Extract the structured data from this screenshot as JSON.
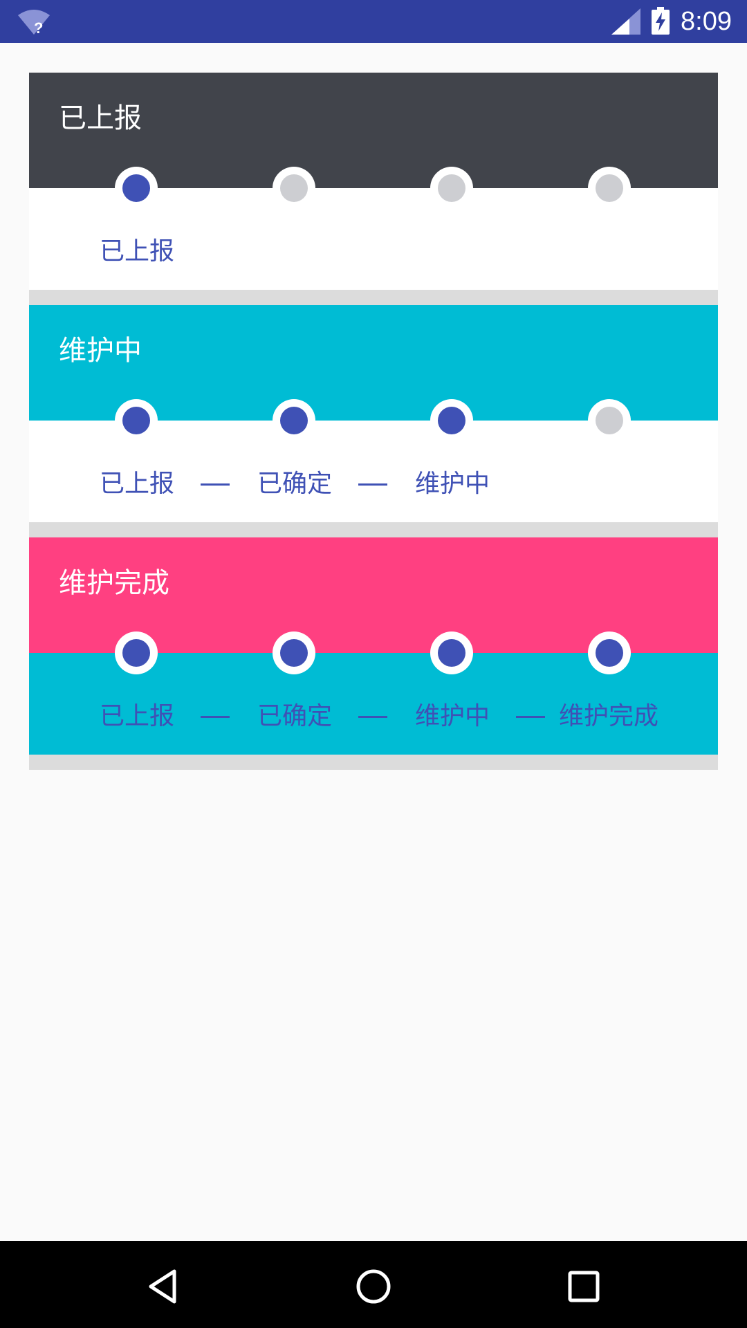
{
  "status_bar": {
    "time": "8:09",
    "icons": [
      "wifi-unknown-icon",
      "cell-signal-icon",
      "battery-charging-icon"
    ],
    "background": "#303f9f"
  },
  "cards": [
    {
      "title": "已上报",
      "header_color": "#41444b",
      "body_color": "#ffffff",
      "steps": [
        {
          "label": "已上报",
          "active": true
        },
        {
          "label": "",
          "active": false
        },
        {
          "label": "",
          "active": false
        },
        {
          "label": "",
          "active": false
        }
      ]
    },
    {
      "title": "维护中",
      "header_color": "#00bcd4",
      "body_color": "#ffffff",
      "steps": [
        {
          "label": "已上报",
          "active": true
        },
        {
          "label": "已确定",
          "active": true
        },
        {
          "label": "维护中",
          "active": true
        },
        {
          "label": "",
          "active": false
        }
      ]
    },
    {
      "title": "维护完成",
      "header_color": "#ff4081",
      "body_color": "#00bcd4",
      "steps": [
        {
          "label": "已上报",
          "active": true
        },
        {
          "label": "已确定",
          "active": true
        },
        {
          "label": "维护中",
          "active": true
        },
        {
          "label": "维护完成",
          "active": true
        }
      ]
    }
  ],
  "colors": {
    "active_step": "#3f51b5",
    "inactive_step": "#cdced2",
    "separator": "#dcdcdc"
  },
  "nav_bar": {
    "icons": [
      "back-icon",
      "home-icon",
      "recents-icon"
    ]
  }
}
